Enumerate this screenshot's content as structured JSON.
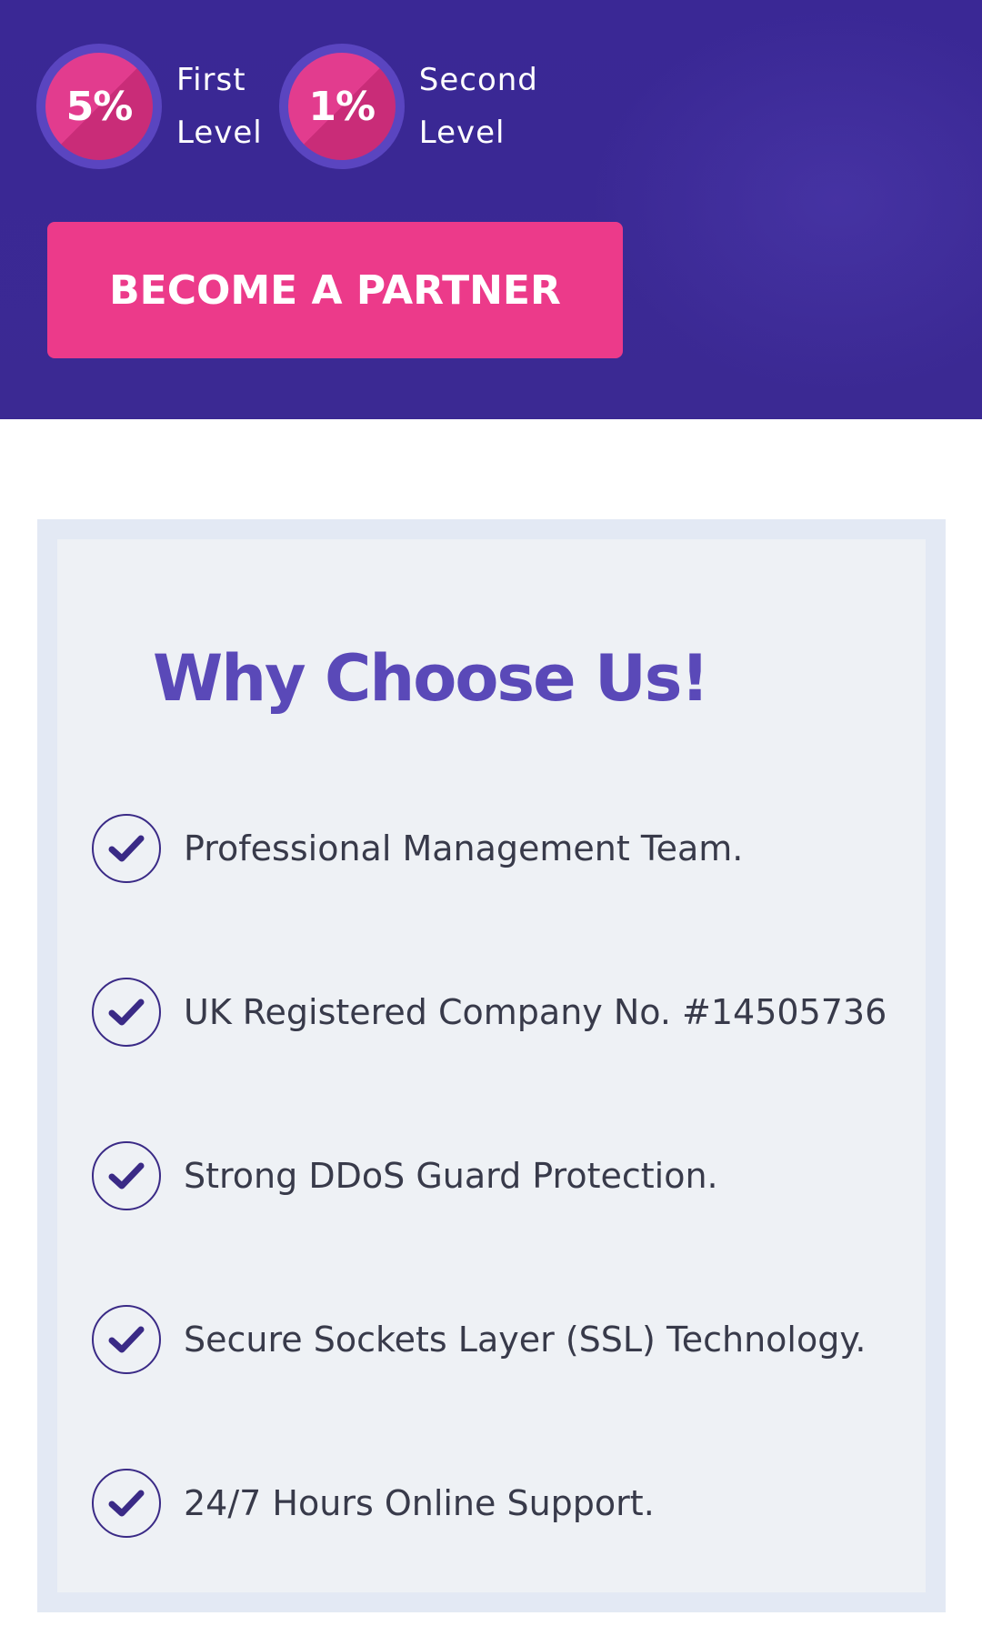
{
  "hero": {
    "levels": [
      {
        "percent": "5%",
        "label_line1": "First",
        "label_line2": "Level"
      },
      {
        "percent": "1%",
        "label_line1": "Second",
        "label_line2": "Level"
      }
    ],
    "button_label": "BECOME A PARTNER"
  },
  "why": {
    "title": "Why Choose Us!",
    "features": [
      "Professional Management Team.",
      "UK Registered Company No. #14505736",
      "Strong DDoS Guard Protection.",
      "Secure Sockets Layer (SSL) Technology.",
      "24/7 Hours Online Support."
    ]
  },
  "colors": {
    "hero_background": "#3b2894",
    "accent_pink": "#ec3a8a",
    "title_purple": "#5a49b8",
    "check_color": "#3a2a86"
  },
  "icons": {
    "feature_icon": "check-circle-icon"
  }
}
